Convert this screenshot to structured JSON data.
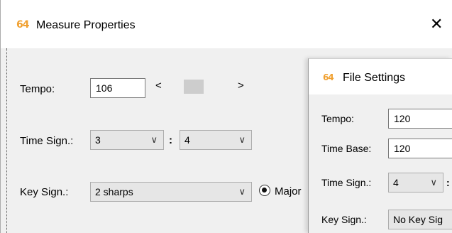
{
  "measure_dialog": {
    "logo": "64",
    "title": "Measure Properties",
    "close_glyph": "✕",
    "tempo_label": "Tempo:",
    "tempo_value": "106",
    "scroll_left": "<",
    "scroll_right": ">",
    "time_sign_label": "Time Sign.:",
    "time_num": "3",
    "time_sep": ":",
    "time_den": "4",
    "key_sign_label": "Key Sign.:",
    "key_value": "2 sharps",
    "mode_label": "Major",
    "chevron": "∨"
  },
  "file_dialog": {
    "logo": "64",
    "title": "File Settings",
    "tempo_label": "Tempo:",
    "tempo_value": "120",
    "time_base_label": "Time Base:",
    "time_base_value": "120",
    "time_sign_label": "Time Sign.:",
    "time_num": "4",
    "time_sep": ":",
    "key_sign_label": "Key Sign.:",
    "key_value": "No Key Sig"
  },
  "colors": {
    "logo": "#f0a030",
    "window_bg": "#f0f0f0",
    "titlebar_bg": "#ffffff"
  }
}
